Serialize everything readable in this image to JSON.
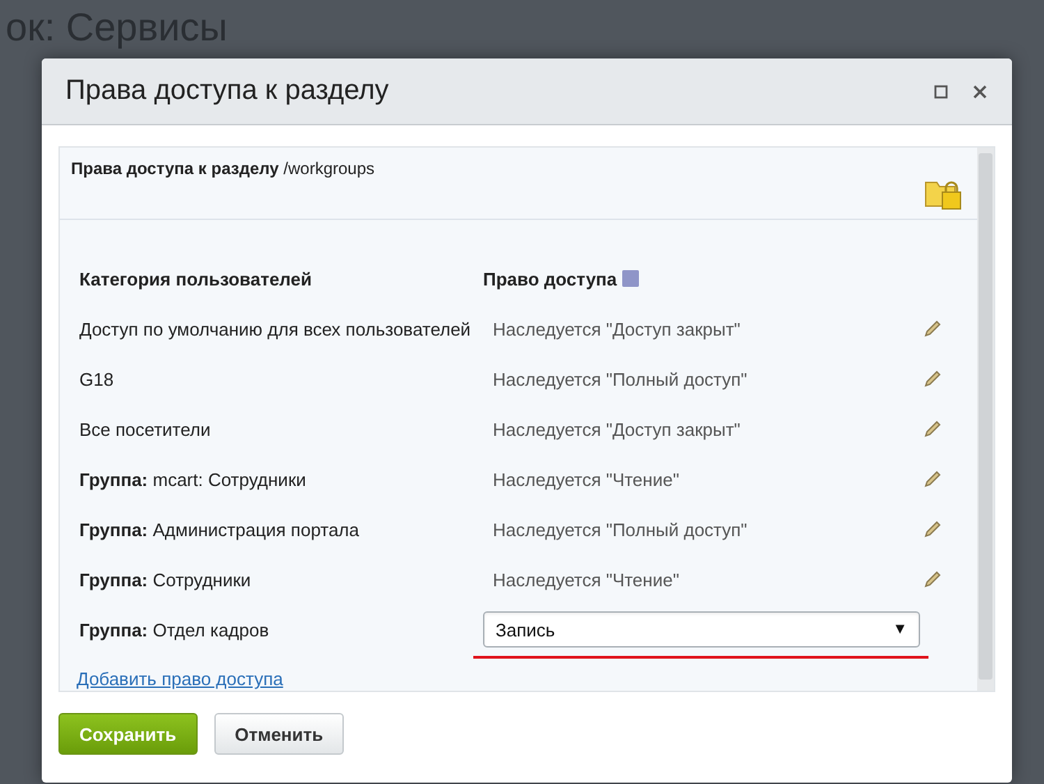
{
  "background_page": {
    "title": "ок: Сервисы"
  },
  "dialog": {
    "title": "Права доступа к разделу",
    "section_header": "**Права доступа к разделу** /workgroups",
    "columns": [
      "Категория пользователей",
      "Право доступа"
    ],
    "rows": [
      {
        "kind": "inherited",
        "category": "Доступ по умолчанию для всех пользователей",
        "access": "Наследуется \"Доступ закрыт\""
      },
      {
        "kind": "inherited",
        "category": "G18",
        "access": "Наследуется \"Полный доступ\""
      },
      {
        "kind": "inherited",
        "category": "Все посетители",
        "access": "Наследуется \"Доступ закрыт\""
      },
      {
        "kind": "inherited",
        "category": "**Группа:** mcart: Сотрудники",
        "access": "Наследуется \"Чтение\""
      },
      {
        "kind": "inherited",
        "category": "**Группа:** Администрация портала",
        "access": "Наследуется \"Полный доступ\""
      },
      {
        "kind": "inherited",
        "category": "**Группа:** Сотрудники",
        "access": "Наследуется \"Чтение\""
      },
      {
        "kind": "select",
        "category": "**Группа:** Отдел кадров",
        "access": "Запись",
        "arrow": "▼"
      }
    ],
    "add_link": "Добавить право доступа",
    "buttons": [
      {
        "kind": "primary",
        "label": "Сохранить"
      },
      {
        "kind": "secondary",
        "label": "Отменить"
      }
    ]
  }
}
